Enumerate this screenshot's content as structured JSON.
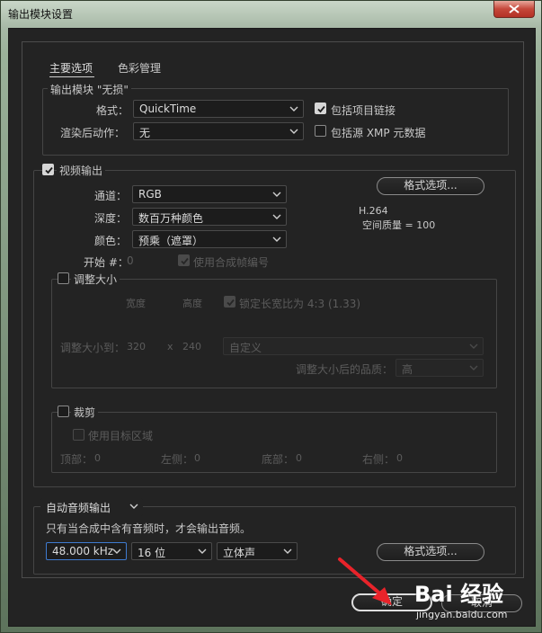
{
  "window": {
    "title": "输出模块设置"
  },
  "tabs": [
    {
      "label": "主要选项"
    },
    {
      "label": "色彩管理"
    }
  ],
  "output_module": {
    "legend": "输出模块 \"无损\"",
    "format_label": "格式：",
    "format_value": "QuickTime",
    "post_render_label": "渲染后动作：",
    "post_render_value": "无",
    "include_project_link": "包括项目链接",
    "include_xmp": "包括源 XMP 元数据"
  },
  "video": {
    "legend": "视频输出",
    "channel_label": "通道：",
    "channel_value": "RGB",
    "depth_label": "深度：",
    "depth_value": "数百万种颜色",
    "color_label": "颜色：",
    "color_value": "预乘（遮罩）",
    "start_label": "开始 #：",
    "start_value": "0",
    "use_comp_frame": "使用合成帧编号",
    "format_options_button": "格式选项...",
    "codec": "H.264",
    "spatial_quality": "空间质量 = 100"
  },
  "resize": {
    "legend": "调整大小",
    "width_header": "宽度",
    "height_header": "高度",
    "lock_aspect": "锁定长宽比为 4:3 (1.33)",
    "resize_to_label": "调整大小到：",
    "width_value": "320",
    "x_sep": "x",
    "height_value": "240",
    "preset_value": "自定义",
    "quality_label": "调整大小后的品质：",
    "quality_value": "高"
  },
  "crop": {
    "legend": "裁剪",
    "use_roi": "使用目标区域",
    "top_label": "顶部：",
    "top_value": "0",
    "left_label": "左侧：",
    "left_value": "0",
    "bottom_label": "底部：",
    "bottom_value": "0",
    "right_label": "右侧：",
    "right_value": "0"
  },
  "audio": {
    "mode_value": "自动音频输出",
    "note": "只有当合成中含有音频时，才会输出音频。",
    "rate_value": "48.000 kHz",
    "bits_value": "16 位",
    "channels_value": "立体声",
    "format_options_button": "格式选项..."
  },
  "footer": {
    "ok_button": "确定",
    "cancel_button": "取消"
  },
  "watermark": {
    "brand": "Bai 经验",
    "url": "jingyan.baidu.com"
  },
  "colors": {
    "client_bg": "#232323",
    "frame_border": "#454545",
    "focus": "#3f7bd0",
    "arrow": "#e8232a",
    "close_button": "#c5473a"
  }
}
